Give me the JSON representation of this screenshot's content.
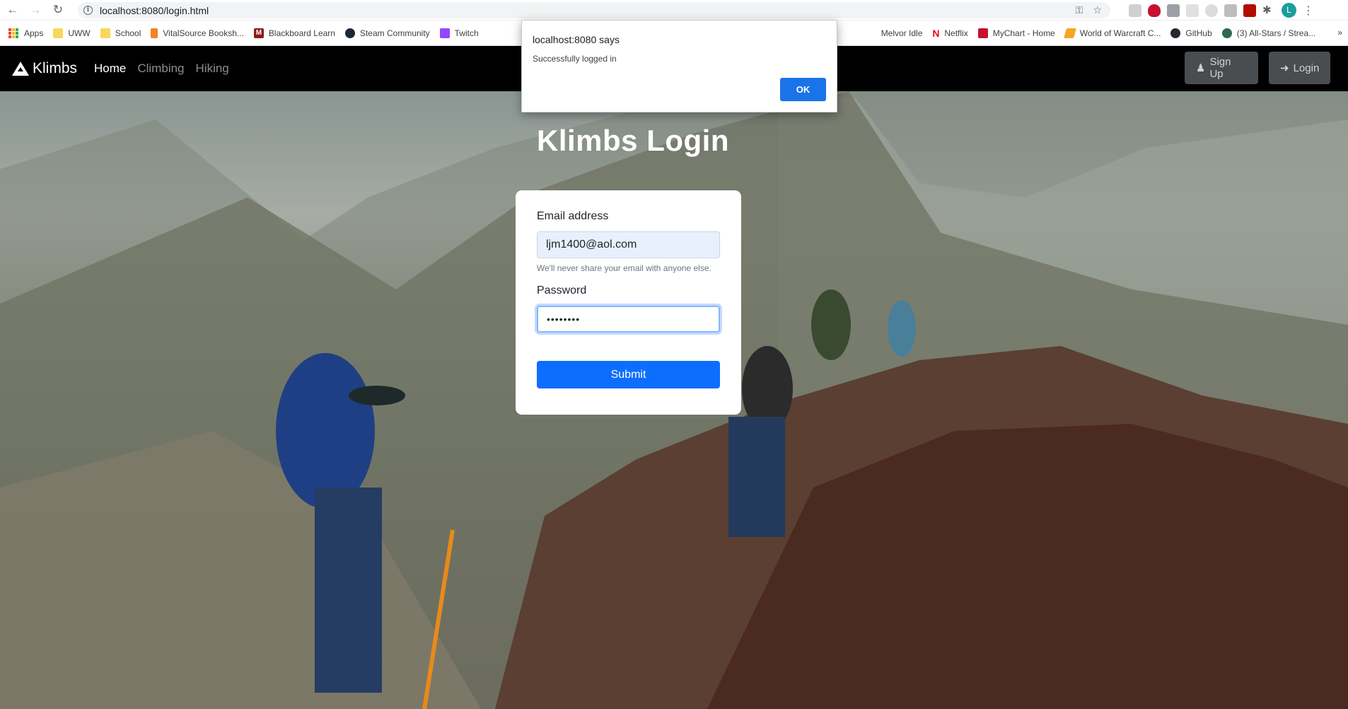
{
  "browser": {
    "url": "localhost:8080/login.html",
    "profile_initial": "L",
    "bookmarks": [
      {
        "label": "Apps"
      },
      {
        "label": "UWW"
      },
      {
        "label": "School"
      },
      {
        "label": "VitalSource Booksh..."
      },
      {
        "label": "Blackboard Learn"
      },
      {
        "label": "Steam Community"
      },
      {
        "label": "Twitch"
      },
      {
        "label": "Melvor Idle"
      },
      {
        "label": "Netflix"
      },
      {
        "label": "MyChart - Home"
      },
      {
        "label": "World of Warcraft C..."
      },
      {
        "label": "GitHub"
      },
      {
        "label": "(3) All-Stars / Strea..."
      }
    ]
  },
  "navbar": {
    "brand": "Klimbs",
    "links": [
      "Home",
      "Climbing",
      "Hiking"
    ],
    "signup_label": "Sign Up",
    "login_label": "Login"
  },
  "page": {
    "title": "Klimbs Login"
  },
  "form": {
    "email_label": "Email address",
    "email_value": "ljm1400@aol.com",
    "email_help": "We'll never share your email with anyone else.",
    "password_label": "Password",
    "password_value": "••••••••",
    "submit_label": "Submit"
  },
  "dialog": {
    "title": "localhost:8080 says",
    "message": "Successfully logged in",
    "ok_label": "OK"
  },
  "colors": {
    "primary": "#0d6efd",
    "navbar_bg": "#000000",
    "dialog_ok": "#1a73e8"
  }
}
